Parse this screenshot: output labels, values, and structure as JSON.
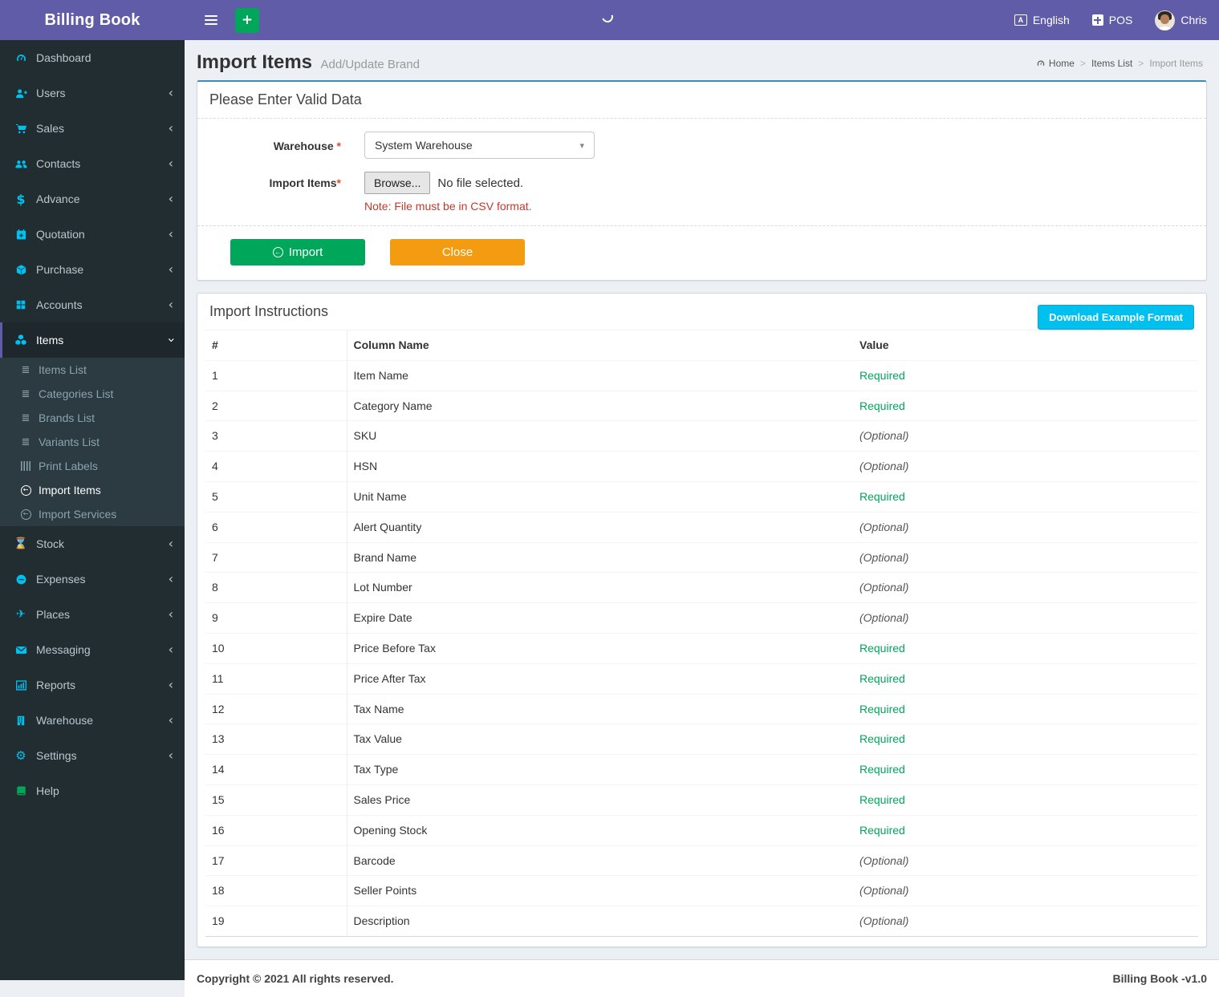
{
  "brand": {
    "title": "Billing Book"
  },
  "header": {
    "language_label": "English",
    "pos_label": "POS",
    "user_name": "Chris"
  },
  "icons": {
    "plus": "+",
    "chevron_left": "‹",
    "caret_down": "▾",
    "dollar": "$",
    "hourglass": "⌛",
    "plane": "✈",
    "gear": "⚙",
    "list": "≣",
    "arrow_left": "←",
    "lang_letter": "A"
  },
  "sidebar": {
    "items": [
      {
        "label": "Dashboard",
        "icon": "gauge-icon"
      },
      {
        "label": "Users",
        "icon": "user-plus-icon"
      },
      {
        "label": "Sales",
        "icon": "cart-icon"
      },
      {
        "label": "Contacts",
        "icon": "users-icon"
      },
      {
        "label": "Advance",
        "icon": "dollar-icon"
      },
      {
        "label": "Quotation",
        "icon": "calendar-plus-icon"
      },
      {
        "label": "Purchase",
        "icon": "cube-icon"
      },
      {
        "label": "Accounts",
        "icon": "grid-icon"
      },
      {
        "label": "Items",
        "icon": "cubes-icon",
        "active": true
      },
      {
        "label": "Stock",
        "icon": "hourglass-icon"
      },
      {
        "label": "Expenses",
        "icon": "minus-circle-icon"
      },
      {
        "label": "Places",
        "icon": "paper-plane-icon"
      },
      {
        "label": "Messaging",
        "icon": "envelope-icon"
      },
      {
        "label": "Reports",
        "icon": "bar-chart-icon"
      },
      {
        "label": "Warehouse",
        "icon": "building-icon"
      },
      {
        "label": "Settings",
        "icon": "gears-icon"
      },
      {
        "label": "Help",
        "icon": "book-icon"
      }
    ],
    "items_submenu": [
      {
        "label": "Items List"
      },
      {
        "label": "Categories List"
      },
      {
        "label": "Brands List"
      },
      {
        "label": "Variants List"
      },
      {
        "label": "Print Labels"
      },
      {
        "label": "Import Items",
        "active": true
      },
      {
        "label": "Import Services"
      }
    ]
  },
  "page": {
    "title": "Import Items",
    "subtitle": "Add/Update Brand",
    "breadcrumb": {
      "home": "Home",
      "parent": "Items List",
      "current": "Import Items",
      "separator": ">"
    }
  },
  "form": {
    "panel_title": "Please Enter Valid Data",
    "warehouse_label": "Warehouse",
    "warehouse_required": "*",
    "warehouse_value": "System Warehouse",
    "import_label": "Import Items",
    "import_required": "*",
    "browse_label": "Browse...",
    "file_status": "No file selected.",
    "note": "Note: File must be in CSV format.",
    "import_button": "Import",
    "close_button": "Close"
  },
  "instructions": {
    "panel_title": "Import Instructions",
    "download_button": "Download Example Format",
    "columns": {
      "num": "#",
      "name": "Column Name",
      "value": "Value"
    },
    "rows": [
      {
        "n": "1",
        "name": "Item Name",
        "value": "Required"
      },
      {
        "n": "2",
        "name": "Category Name",
        "value": "Required"
      },
      {
        "n": "3",
        "name": "SKU",
        "value": "(Optional)"
      },
      {
        "n": "4",
        "name": "HSN",
        "value": "(Optional)"
      },
      {
        "n": "5",
        "name": "Unit Name",
        "value": "Required"
      },
      {
        "n": "6",
        "name": "Alert Quantity",
        "value": "(Optional)"
      },
      {
        "n": "7",
        "name": "Brand Name",
        "value": "(Optional)"
      },
      {
        "n": "8",
        "name": "Lot Number",
        "value": "(Optional)"
      },
      {
        "n": "9",
        "name": "Expire Date",
        "value": "(Optional)"
      },
      {
        "n": "10",
        "name": "Price Before Tax",
        "value": "Required"
      },
      {
        "n": "11",
        "name": "Price After Tax",
        "value": "Required"
      },
      {
        "n": "12",
        "name": "Tax Name",
        "value": "Required"
      },
      {
        "n": "13",
        "name": "Tax Value",
        "value": "Required"
      },
      {
        "n": "14",
        "name": "Tax Type",
        "value": "Required"
      },
      {
        "n": "15",
        "name": "Sales Price",
        "value": "Required"
      },
      {
        "n": "16",
        "name": "Opening Stock",
        "value": "Required"
      },
      {
        "n": "17",
        "name": "Barcode",
        "value": "(Optional)"
      },
      {
        "n": "18",
        "name": "Seller Points",
        "value": "(Optional)"
      },
      {
        "n": "19",
        "name": "Description",
        "value": "(Optional)"
      }
    ]
  },
  "footer": {
    "copyright": "Copyright © 2021 All rights reserved.",
    "version": "Billing Book -v1.0"
  },
  "colors": {
    "header_purple": "#605ca8",
    "sidebar_dark": "#222d32",
    "submenu_dark": "#2c3b41",
    "accent_cyan": "#00c0ef",
    "green": "#00a65a",
    "orange": "#f39c12",
    "panel_top_blue": "#3c8dbc",
    "required_green": "#00a65a",
    "note_red": "#c0392b"
  }
}
